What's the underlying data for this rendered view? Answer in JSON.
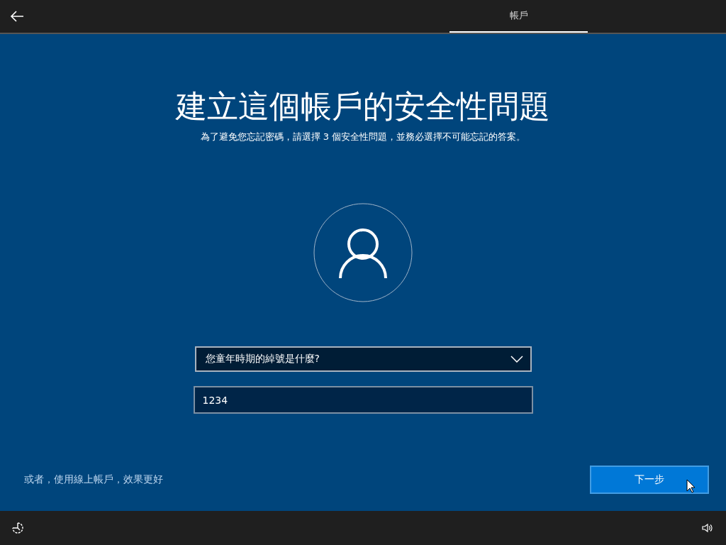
{
  "tabs": [
    {
      "label": "帳戶",
      "selected": true
    }
  ],
  "title": "建立這個帳戶的安全性問題",
  "subtitle": "為了避免您忘記密碼，請選擇 3 個安全性問題，並務必選擇不可能忘記的答案。",
  "question_dropdown": {
    "value": "您童年時期的綽號是什麼?"
  },
  "answer_field": {
    "value": "1234"
  },
  "online_account_link": "或者，使用線上帳戶，效果更好",
  "next_button": "下一步"
}
